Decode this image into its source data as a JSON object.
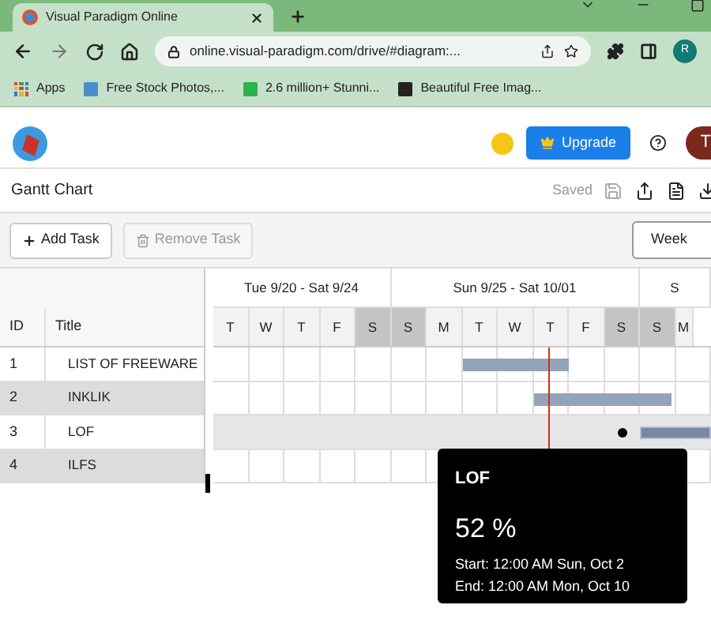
{
  "browser": {
    "tab_title": "Visual Paradigm Online",
    "url": "online.visual-paradigm.com/drive/#diagram:...",
    "profile_initial": "R",
    "bookmarks": [
      "Apps",
      "Free Stock Photos,...",
      "2.6 million+ Stunni...",
      "Beautiful Free Imag..."
    ]
  },
  "app_header": {
    "upgrade_label": "Upgrade",
    "avatar_initial": "T"
  },
  "document": {
    "title": "Gantt Chart",
    "status": "Saved"
  },
  "toolbar": {
    "add_label": "Add Task",
    "remove_label": "Remove Task",
    "remove_disabled": true,
    "view_label": "Week"
  },
  "table": {
    "columns": [
      "ID",
      "Title"
    ]
  },
  "timeline": {
    "weeks": [
      {
        "label": "Tue 9/20 - Sat 9/24"
      },
      {
        "label": "Sun 9/25 - Sat 10/01"
      },
      {
        "label": "S"
      }
    ],
    "days": [
      {
        "label": "T",
        "weekend": false
      },
      {
        "label": "W",
        "weekend": false
      },
      {
        "label": "T",
        "weekend": false
      },
      {
        "label": "F",
        "weekend": false
      },
      {
        "label": "S",
        "weekend": true
      },
      {
        "label": "S",
        "weekend": true
      },
      {
        "label": "M",
        "weekend": false
      },
      {
        "label": "T",
        "weekend": false
      },
      {
        "label": "W",
        "weekend": false
      },
      {
        "label": "T",
        "weekend": false
      },
      {
        "label": "F",
        "weekend": false
      },
      {
        "label": "S",
        "weekend": true
      },
      {
        "label": "S",
        "weekend": true
      },
      {
        "label": "M",
        "weekend": false
      }
    ]
  },
  "tasks": [
    {
      "id": "1",
      "title": "LIST OF FREEWARE",
      "selected": false
    },
    {
      "id": "2",
      "title": "INKLIK",
      "selected": false
    },
    {
      "id": "3",
      "title": "LOF",
      "selected": true
    },
    {
      "id": "4",
      "title": "ILFS",
      "selected": false
    }
  ],
  "tooltip": {
    "title": "LOF",
    "percent": "52 %",
    "start": "Start: 12:00 AM Sun, Oct 2",
    "end": "End: 12:00 AM Mon, Oct 10"
  }
}
